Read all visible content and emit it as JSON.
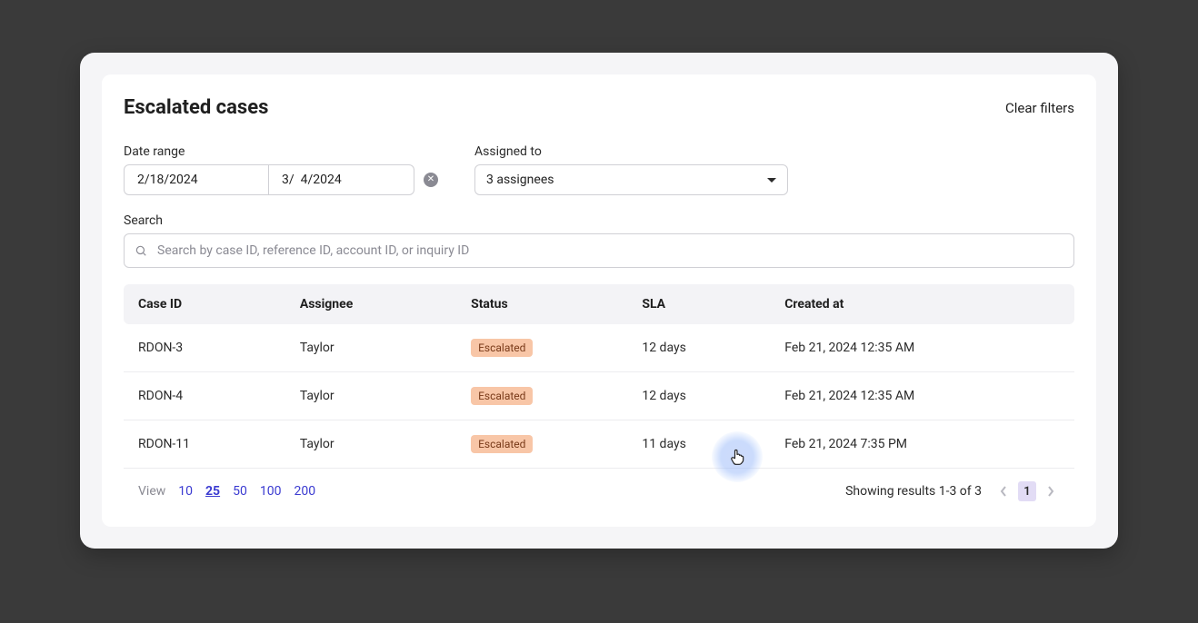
{
  "header": {
    "title": "Escalated cases",
    "clear_filters": "Clear filters"
  },
  "filters": {
    "date_range_label": "Date range",
    "date_start": "2/18/2024",
    "date_end": "3/  4/2024",
    "assigned_to_label": "Assigned to",
    "assigned_to_value": "3 assignees"
  },
  "search": {
    "label": "Search",
    "placeholder": "Search by case ID, reference ID, account ID, or inquiry ID"
  },
  "table": {
    "columns": {
      "case_id": "Case ID",
      "assignee": "Assignee",
      "status": "Status",
      "sla": "SLA",
      "created_at": "Created at"
    },
    "rows": [
      {
        "case_id": "RDON-3",
        "assignee": "Taylor",
        "status": "Escalated",
        "sla": "12 days",
        "created_at": "Feb 21, 2024 12:35 AM"
      },
      {
        "case_id": "RDON-4",
        "assignee": "Taylor",
        "status": "Escalated",
        "sla": "12 days",
        "created_at": "Feb 21, 2024 12:35 AM"
      },
      {
        "case_id": "RDON-11",
        "assignee": "Taylor",
        "status": "Escalated",
        "sla": "11 days",
        "created_at": "Feb 21, 2024 7:35 PM"
      }
    ]
  },
  "footer": {
    "view_label": "View",
    "page_sizes": [
      "10",
      "25",
      "50",
      "100",
      "200"
    ],
    "active_page_size": "25",
    "results_text": "Showing results 1-3 of 3",
    "current_page": "1"
  }
}
